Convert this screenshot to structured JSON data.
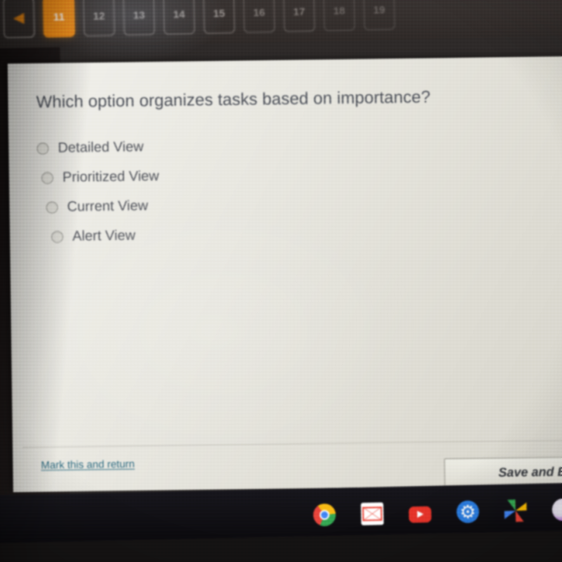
{
  "nav": {
    "prev_label": "◀",
    "prev_name": "previous",
    "buttons": [
      {
        "label": "11",
        "active": true
      },
      {
        "label": "12",
        "active": false
      },
      {
        "label": "13",
        "active": false
      },
      {
        "label": "14",
        "active": false
      },
      {
        "label": "15",
        "active": false
      },
      {
        "label": "16",
        "active": false
      },
      {
        "label": "17",
        "active": false
      },
      {
        "label": "18",
        "active": false
      },
      {
        "label": "19",
        "active": false
      }
    ],
    "active_accent": "#ef8b15"
  },
  "quiz": {
    "question": "Which option organizes tasks based on importance?",
    "options": [
      {
        "label": "Detailed View",
        "selected": false
      },
      {
        "label": "Prioritized View",
        "selected": false
      },
      {
        "label": "Current View",
        "selected": false
      },
      {
        "label": "Alert View",
        "selected": false
      }
    ]
  },
  "footer": {
    "mark_link": "Mark this and return",
    "mark_link_color": "#2d6b82",
    "save_button": "Save and E"
  },
  "shelf": {
    "icons": [
      {
        "name": "chrome-icon"
      },
      {
        "name": "gmail-icon"
      },
      {
        "name": "youtube-icon"
      },
      {
        "name": "settings-icon"
      },
      {
        "name": "google-photos-icon"
      },
      {
        "name": "edge-browser-icon"
      }
    ]
  }
}
